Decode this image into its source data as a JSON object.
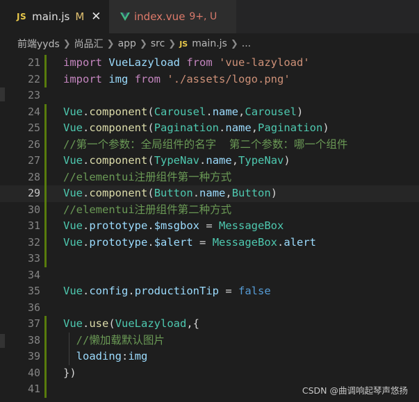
{
  "tabs": [
    {
      "badge": "JS",
      "name": "main.js",
      "status": "M",
      "close": "✕"
    },
    {
      "name": "index.vue",
      "status": "9+, U"
    }
  ],
  "breadcrumb": {
    "parts": [
      "前端yyds",
      "尚品汇",
      "app",
      "src"
    ],
    "file_badge": "JS",
    "file": "main.js",
    "tail": "..."
  },
  "editor": {
    "current_line": 29,
    "lines": [
      {
        "n": "21",
        "tokens": [
          [
            "kw",
            "import"
          ],
          [
            "pl",
            " "
          ],
          [
            "var",
            "VueLazyload"
          ],
          [
            "pl",
            " "
          ],
          [
            "kw",
            "from"
          ],
          [
            "pl",
            " "
          ],
          [
            "str",
            "'vue-lazyload'"
          ]
        ]
      },
      {
        "n": "22",
        "tokens": [
          [
            "kw",
            "import"
          ],
          [
            "pl",
            " "
          ],
          [
            "var",
            "img"
          ],
          [
            "pl",
            " "
          ],
          [
            "kw",
            "from"
          ],
          [
            "pl",
            " "
          ],
          [
            "str",
            "'./assets/logo.png'"
          ]
        ]
      },
      {
        "n": "23",
        "tokens": []
      },
      {
        "n": "24",
        "tokens": [
          [
            "cls",
            "Vue"
          ],
          [
            "pl",
            "."
          ],
          [
            "fn",
            "component"
          ],
          [
            "pl",
            "("
          ],
          [
            "cls",
            "Carousel"
          ],
          [
            "pl",
            "."
          ],
          [
            "var",
            "name"
          ],
          [
            "pl",
            ","
          ],
          [
            "cls",
            "Carousel"
          ],
          [
            "pl",
            ")"
          ]
        ]
      },
      {
        "n": "25",
        "tokens": [
          [
            "cls",
            "Vue"
          ],
          [
            "pl",
            "."
          ],
          [
            "fn",
            "component"
          ],
          [
            "pl",
            "("
          ],
          [
            "cls",
            "Pagination"
          ],
          [
            "pl",
            "."
          ],
          [
            "var",
            "name"
          ],
          [
            "pl",
            ","
          ],
          [
            "cls",
            "Pagination"
          ],
          [
            "pl",
            ")"
          ]
        ]
      },
      {
        "n": "26",
        "tokens": [
          [
            "cmt",
            "//第一个参数：全局组件的名字  第二个参数：哪一个组件"
          ]
        ]
      },
      {
        "n": "27",
        "tokens": [
          [
            "cls",
            "Vue"
          ],
          [
            "pl",
            "."
          ],
          [
            "fn",
            "component"
          ],
          [
            "pl",
            "("
          ],
          [
            "cls",
            "TypeNav"
          ],
          [
            "pl",
            "."
          ],
          [
            "var",
            "name"
          ],
          [
            "pl",
            ","
          ],
          [
            "cls",
            "TypeNav"
          ],
          [
            "pl",
            ")"
          ]
        ]
      },
      {
        "n": "28",
        "tokens": [
          [
            "cmt",
            "//elementui注册组件第一种方式"
          ]
        ]
      },
      {
        "n": "29",
        "tokens": [
          [
            "cls",
            "Vue"
          ],
          [
            "pl",
            "."
          ],
          [
            "fn",
            "component"
          ],
          [
            "pl",
            "("
          ],
          [
            "cls",
            "Button"
          ],
          [
            "pl",
            "."
          ],
          [
            "var",
            "name"
          ],
          [
            "pl",
            ","
          ],
          [
            "cls",
            "Button"
          ],
          [
            "pl",
            ")"
          ]
        ]
      },
      {
        "n": "30",
        "tokens": [
          [
            "cmt",
            "//elementui注册组件第二种方式"
          ]
        ]
      },
      {
        "n": "31",
        "tokens": [
          [
            "cls",
            "Vue"
          ],
          [
            "pl",
            "."
          ],
          [
            "var",
            "prototype"
          ],
          [
            "pl",
            "."
          ],
          [
            "var",
            "$msgbox"
          ],
          [
            "pl",
            " = "
          ],
          [
            "cls",
            "MessageBox"
          ]
        ]
      },
      {
        "n": "32",
        "tokens": [
          [
            "cls",
            "Vue"
          ],
          [
            "pl",
            "."
          ],
          [
            "var",
            "prototype"
          ],
          [
            "pl",
            "."
          ],
          [
            "var",
            "$alert"
          ],
          [
            "pl",
            " = "
          ],
          [
            "cls",
            "MessageBox"
          ],
          [
            "pl",
            "."
          ],
          [
            "var",
            "alert"
          ]
        ]
      },
      {
        "n": "33",
        "tokens": []
      },
      {
        "n": "34",
        "tokens": []
      },
      {
        "n": "35",
        "tokens": [
          [
            "cls",
            "Vue"
          ],
          [
            "pl",
            "."
          ],
          [
            "var",
            "config"
          ],
          [
            "pl",
            "."
          ],
          [
            "var",
            "productionTip"
          ],
          [
            "pl",
            " = "
          ],
          [
            "kb",
            "false"
          ]
        ]
      },
      {
        "n": "36",
        "tokens": []
      },
      {
        "n": "37",
        "tokens": [
          [
            "cls",
            "Vue"
          ],
          [
            "pl",
            "."
          ],
          [
            "fn",
            "use"
          ],
          [
            "pl",
            "("
          ],
          [
            "cls",
            "VueLazyload"
          ],
          [
            "pl",
            ",{"
          ]
        ]
      },
      {
        "n": "38",
        "tokens": [
          [
            "pl",
            "  "
          ],
          [
            "cmt",
            "//懒加载默认图片"
          ]
        ]
      },
      {
        "n": "39",
        "tokens": [
          [
            "pl",
            "  "
          ],
          [
            "var",
            "loading"
          ],
          [
            "pl",
            ":"
          ],
          [
            "var",
            "img"
          ]
        ]
      },
      {
        "n": "40",
        "tokens": [
          [
            "pl",
            "})"
          ]
        ]
      },
      {
        "n": "41",
        "tokens": []
      }
    ]
  },
  "watermark": "CSDN @曲调响起琴声悠扬",
  "colors": {
    "background": "#1e1e1e",
    "keyword": "#c586c0",
    "string": "#ce9178",
    "variable": "#9cdcfe",
    "type": "#4ec9b0",
    "function": "#dcdcaa",
    "comment": "#6a9955",
    "git_added_bar": "#587c0c"
  }
}
